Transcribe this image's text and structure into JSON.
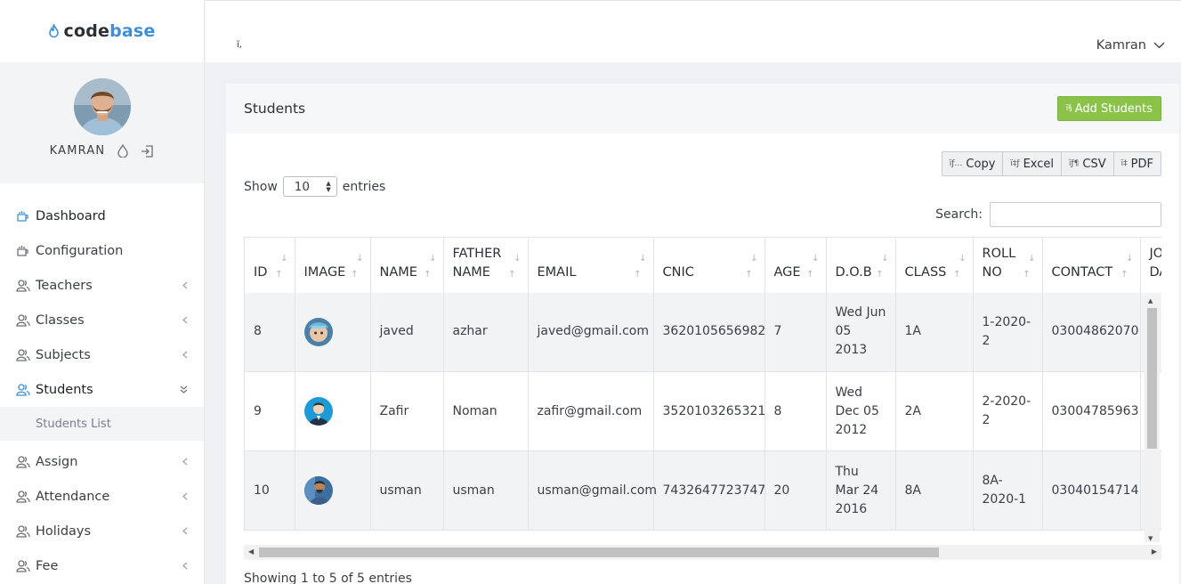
{
  "brand": {
    "part1": "code",
    "part2": "base"
  },
  "profile": {
    "name": "KAMRAN"
  },
  "nav": [
    {
      "label": "Dashboard",
      "icon": "dashboard-icon",
      "chevron": false
    },
    {
      "label": "Configuration",
      "icon": "configuration-icon",
      "chevron": false
    },
    {
      "label": "Teachers",
      "icon": "users-icon",
      "chevron": true
    },
    {
      "label": "Classes",
      "icon": "users-icon",
      "chevron": true
    },
    {
      "label": "Subjects",
      "icon": "users-icon",
      "chevron": true
    },
    {
      "label": "Students",
      "icon": "users-icon",
      "chevron": "open"
    },
    {
      "label": "Assign",
      "icon": "users-icon",
      "chevron": true
    },
    {
      "label": "Attendance",
      "icon": "users-icon",
      "chevron": true
    },
    {
      "label": "Holidays",
      "icon": "users-icon",
      "chevron": true
    },
    {
      "label": "Fee",
      "icon": "users-icon",
      "chevron": true
    }
  ],
  "nav_sub": {
    "students_list": "Students List"
  },
  "topbar": {
    "glyph": "ï,",
    "user": "Kamran"
  },
  "card": {
    "title": "Students",
    "add_button": "Add Students",
    "add_glyph": "ï§"
  },
  "exports": [
    {
      "glyph": "ïƒ…",
      "label": "Copy"
    },
    {
      "glyph": "ï‡ƒ",
      "label": "Excel"
    },
    {
      "glyph": "ïƒ¶",
      "label": "CSV"
    },
    {
      "glyph": "ï‡",
      "label": "PDF"
    }
  ],
  "length": {
    "show": "Show",
    "value": "10",
    "entries": "entries"
  },
  "search": {
    "label": "Search:",
    "value": ""
  },
  "table": {
    "headers": [
      "ID",
      "IMAGE",
      "NAME",
      "FATHER NAME",
      "EMAIL",
      "CNIC",
      "AGE",
      "D.O.B",
      "CLASS",
      "ROLL NO",
      "CONTACT",
      "JO DA"
    ],
    "rows": [
      {
        "id": "8",
        "name": "javed",
        "father": "azhar",
        "email": "javed@gmail.com",
        "cnic": "3620105656982",
        "age": "7",
        "dob": "Wed Jun 05 2013",
        "class": "1A",
        "roll": "1-2020-2",
        "contact": "03004862070"
      },
      {
        "id": "9",
        "name": "Zafir",
        "father": "Noman",
        "email": "zafir@gmail.com",
        "cnic": "3520103265321",
        "age": "8",
        "dob": "Wed Dec 05 2012",
        "class": "2A",
        "roll": "2-2020-2",
        "contact": "03004785963"
      },
      {
        "id": "10",
        "name": "usman",
        "father": "usman",
        "email": "usman@gmail.com",
        "cnic": "7432647723747",
        "age": "20",
        "dob": "Thu Mar 24 2016",
        "class": "8A",
        "roll": "8A-2020-1",
        "contact": "03040154714"
      }
    ]
  },
  "footer": {
    "info": "Showing 1 to 5 of 5 entries"
  },
  "colors": {
    "accent": "#3f8fd6",
    "add_button": "#8bc34a"
  }
}
